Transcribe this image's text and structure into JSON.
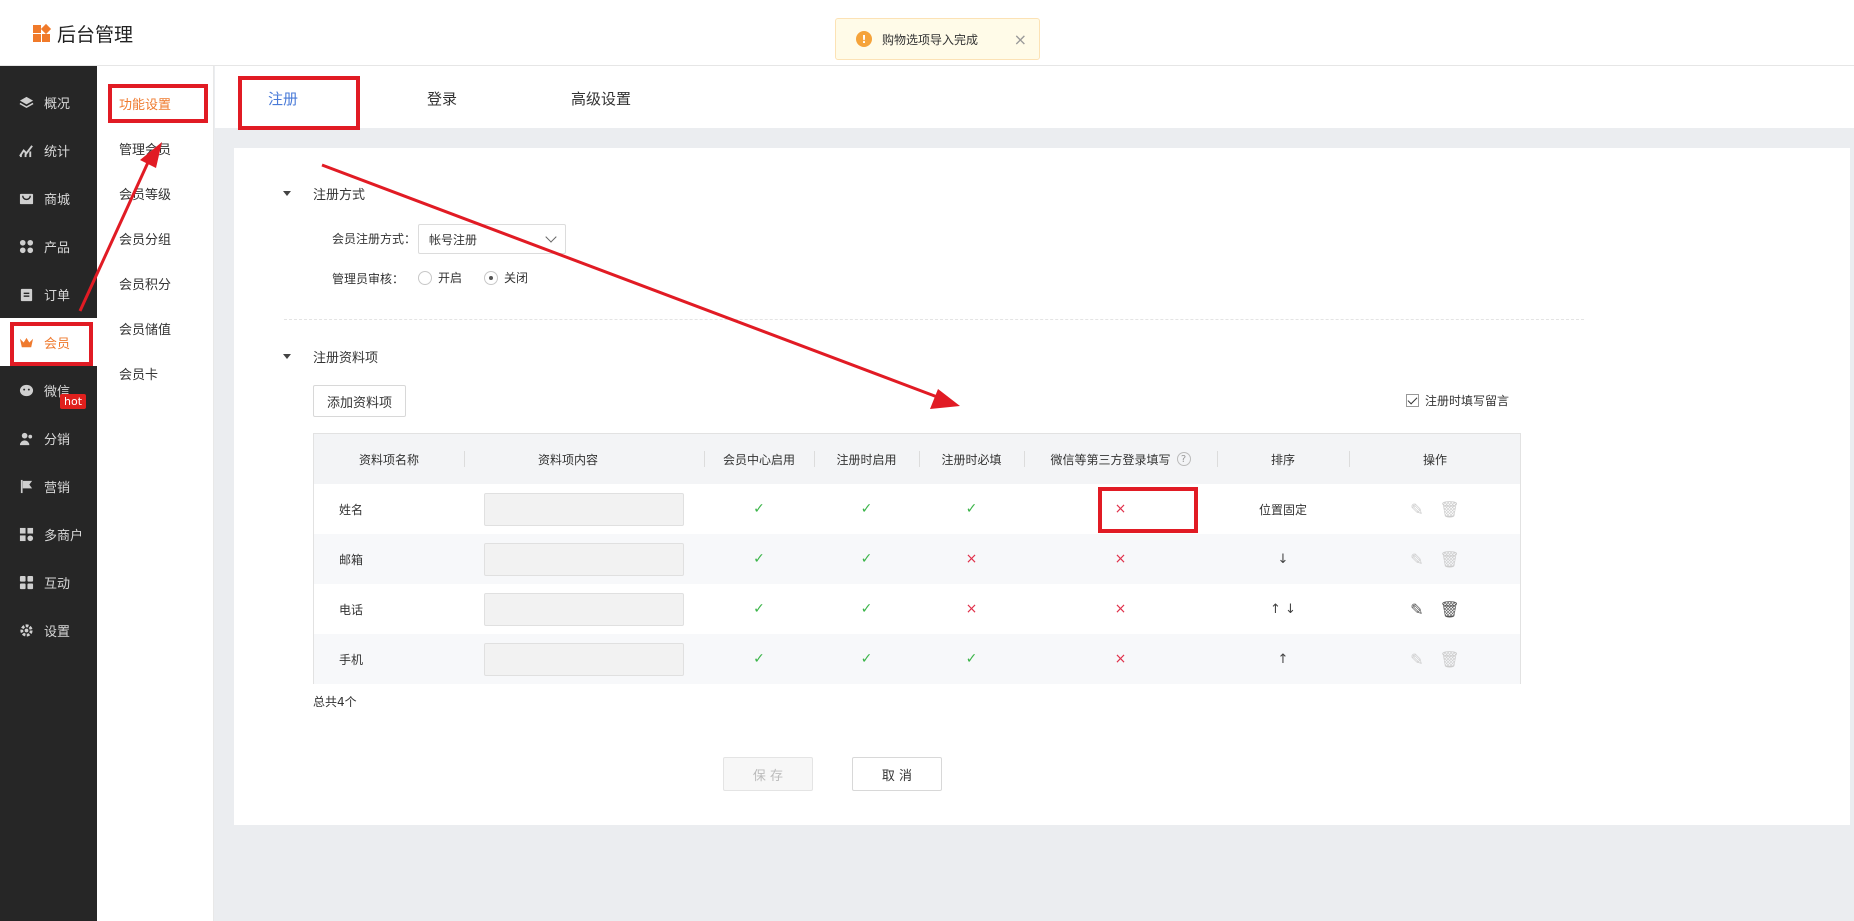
{
  "app": {
    "title": "后台管理"
  },
  "toast": {
    "text": "购物选项导入完成",
    "close": "×"
  },
  "sidebar": {
    "items": [
      {
        "label": "概况",
        "icon": "layers-icon"
      },
      {
        "label": "统计",
        "icon": "chart-icon"
      },
      {
        "label": "商城",
        "icon": "shop-icon"
      },
      {
        "label": "产品",
        "icon": "grid-icon"
      },
      {
        "label": "订单",
        "icon": "clipboard-icon"
      },
      {
        "label": "会员",
        "icon": "crown-icon"
      },
      {
        "label": "微信",
        "icon": "wechat-icon"
      },
      {
        "label": "分销",
        "icon": "users-icon"
      },
      {
        "label": "营销",
        "icon": "flag-icon"
      },
      {
        "label": "多商户",
        "icon": "store-icon"
      },
      {
        "label": "互动",
        "icon": "puzzle-icon"
      },
      {
        "label": "设置",
        "icon": "gear-icon"
      }
    ],
    "hot_badge": "hot",
    "active": "会员"
  },
  "subnav": {
    "items": [
      "功能设置",
      "管理会员",
      "会员等级",
      "会员分组",
      "会员积分",
      "会员储值",
      "会员卡"
    ],
    "active": "功能设置"
  },
  "tabs": {
    "items": [
      "注册",
      "登录",
      "高级设置"
    ],
    "active": "注册"
  },
  "reg_method": {
    "title": "注册方式",
    "method_label": "会员注册方式：",
    "method_value": "帐号注册",
    "audit_label": "管理员审核：",
    "audit_on": "开启",
    "audit_off": "关闭",
    "audit_selected": "关闭"
  },
  "reg_items": {
    "title": "注册资料项",
    "add_button": "添加资料项",
    "memo_checkbox": "注册时填写留言",
    "memo_checked": true,
    "columns": [
      "资料项名称",
      "资料项内容",
      "会员中心启用",
      "注册时启用",
      "注册时必填",
      "微信等第三方登录填写",
      "排序",
      "操作"
    ],
    "rows": [
      {
        "name": "姓名",
        "center": "✓",
        "reg_enable": "✓",
        "required": "✓",
        "third": "×",
        "sort": "位置固定"
      },
      {
        "name": "邮箱",
        "center": "✓",
        "reg_enable": "✓",
        "required": "×",
        "third": "×",
        "sort": "↓"
      },
      {
        "name": "电话",
        "center": "✓",
        "reg_enable": "✓",
        "required": "×",
        "third": "×",
        "sort": "↑ ↓"
      },
      {
        "name": "手机",
        "center": "✓",
        "reg_enable": "✓",
        "required": "✓",
        "third": "×",
        "sort": "↑"
      }
    ],
    "total": "总共4个"
  },
  "actions": {
    "save": "保 存",
    "cancel": "取 消"
  },
  "colors": {
    "accent": "#ef7a2e",
    "tab_active": "#4a7bd8",
    "annotation": "#e11b24",
    "ok": "#3cb54a",
    "no": "#e0304a"
  }
}
